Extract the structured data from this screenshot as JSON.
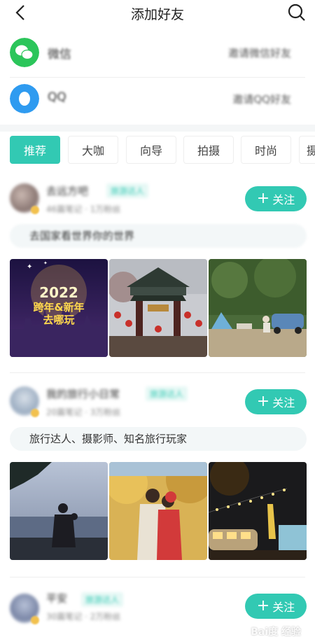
{
  "header": {
    "title": "添加好友",
    "back_icon": "chevron-left-icon",
    "search_icon": "search-icon"
  },
  "invites": [
    {
      "name": "微信",
      "link": "邀请微信好友",
      "icon": "wechat-icon",
      "color": "#2bc55a"
    },
    {
      "name": "QQ",
      "link": "邀请QQ好友",
      "icon": "qq-icon",
      "color": "#2f9bf0"
    }
  ],
  "tabs": [
    "推荐",
    "大咖",
    "向导",
    "拍摄",
    "时尚",
    "摄"
  ],
  "active_tab": "推荐",
  "accent_color": "#32c9b3",
  "cards": [
    {
      "username": "去远方吧",
      "tag": "旅游达人",
      "meta": "46篇笔记 · 1万粉丝",
      "follow_label": "关注",
      "intro": "去国家看世界你的世界",
      "photos": [
        {
          "caption": "2022 跨年&新年 去哪玩"
        },
        {
          "caption": ""
        },
        {
          "caption": ""
        }
      ]
    },
    {
      "username": "我的旅行小日常",
      "tag": "旅游达人",
      "meta": "20篇笔记 · 3万粉丝",
      "follow_label": "关注",
      "intro": "旅行达人、摄影师、知名旅行玩家",
      "photos": [
        {
          "caption": ""
        },
        {
          "caption": ""
        },
        {
          "caption": ""
        }
      ]
    },
    {
      "username": "平安",
      "tag": "旅游达人",
      "meta": "30篇笔记 · 2万粉丝",
      "follow_label": "关注",
      "intro": "",
      "photos": []
    }
  ],
  "watermark": "Bai度 经验"
}
